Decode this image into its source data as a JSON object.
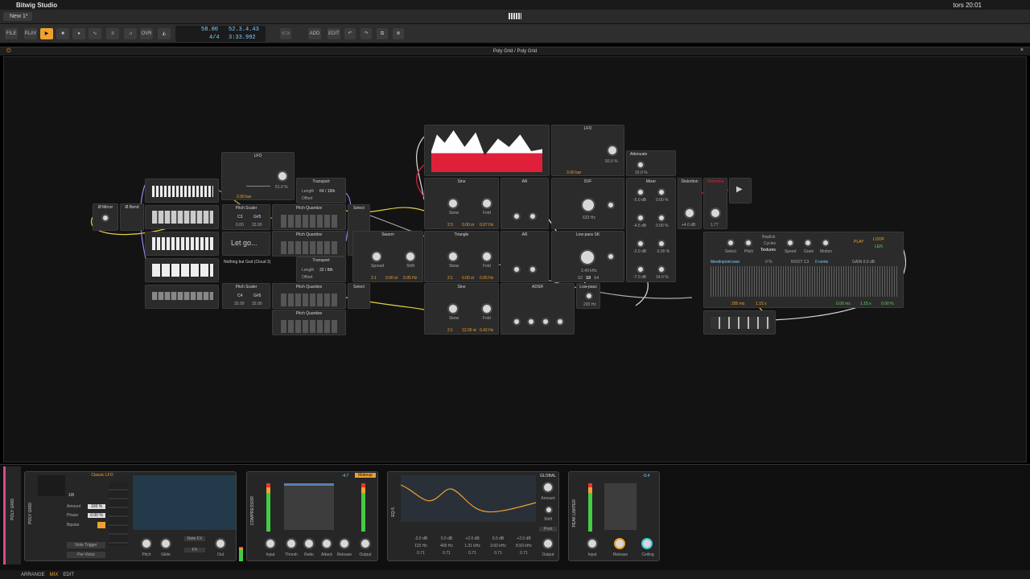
{
  "mac": {
    "app": "Bitwig Studio",
    "clock": "tors 20:01"
  },
  "tab": {
    "label": "New 1*"
  },
  "transport": {
    "file": "FILE",
    "play": "PLAY",
    "add": "ADD",
    "edit": "EDIT",
    "ovr": "OVR",
    "tempo": "58.00",
    "time_sig": "4/4",
    "position": "52.3.4.43",
    "time": "3:33.992"
  },
  "panel": {
    "title": "Poly Grid / Poly Grid"
  },
  "modules": {
    "lfo1": "LFO",
    "lfo1_rate": "2.00 bar",
    "lfo1_val": "51.0 %",
    "mirror": "Ø Mirror",
    "bend": "Ø Bend",
    "transport1": "Transport",
    "transport1_len": "Length",
    "transport1_lenv": "64 / 16th",
    "transport1_off": "Offset",
    "transport2": "Transport",
    "transport2_len": "Length",
    "transport2_lenv": "32 / 8th",
    "transport2_off": "Offset",
    "pitchscaler1": "Pitch Scaler",
    "ps1_c": "C3",
    "ps1_g": "G#5",
    "ps1_a": "0.00",
    "ps1_b": "32.00",
    "pitchscaler2": "Pitch Scaler",
    "ps2_c": "C4",
    "ps2_g": "G#5",
    "ps2_a": "32.00",
    "ps2_b": "32.00",
    "pq": "Pitch Quantize",
    "pqz": "Pitch Quantize",
    "select": "Select",
    "letgo": "Let go...",
    "comment": "Nothing but God (Cloud 3)",
    "swarm": "Swarm",
    "spread": "Spread",
    "shift": "Shift",
    "swarm_a": "2:1",
    "swarm_b": "0.00 st",
    "swarm_c": "0.05 Hz",
    "sine1": "Sine",
    "triangle": "Triangle",
    "sine2": "Sine",
    "skew": "Skew",
    "fold": "Fold",
    "osc1_a": "2:3",
    "osc1_b": "0.00 st",
    "osc1_c": "0.07 Hz",
    "osc2_a": "2:1",
    "osc2_b": "0.00 st",
    "osc2_c": "0.05 Hz",
    "osc3_a": "2:1",
    "osc3_b": "12.00 st",
    "osc3_c": "0.42 Hz",
    "ar1": "AR",
    "ar2": "AR",
    "adsr": "ADSR",
    "lfo2": "LFO",
    "lfo2_rate": "3.00 bar",
    "lfo2_val": "50.0 %",
    "attenuate": "Attenuate",
    "att_val": "15.0 %",
    "svf": "SVF",
    "svf_freq": "633 Hz",
    "lp": "Low-pass SK",
    "lp_freq": "2.40 kHz",
    "lp_a": "S2",
    "lp_b": "S8",
    "lp_c": "S4",
    "lowpass": "Low-pass",
    "lowpass_freq": "220 Hz",
    "mixer": "Mixer",
    "mix1a": "-5.0 dB",
    "mix1b": "0.00 %",
    "mix2a": "-4.5 dB",
    "mix2b": "0.00 %",
    "mix3a": "-2.0 dB",
    "mix3b": "-3.00 %",
    "mix4a": "-7.0 dB",
    "mix4b": "14.0 %",
    "distortion": "Distortion",
    "dist_val": "+4.0 dB",
    "dist2": "Distortion",
    "dist2_val": "1.77",
    "replick": "Replick",
    "cycles": "Cycles",
    "textures": "Textures",
    "sampler_play": "PLAY",
    "sampler_loop": "LOOP",
    "sampler_len": "LEN",
    "sampler_file": "Meetinpoint.wav",
    "sampler_pct": "0 %",
    "sampler_root": "ROOT C3",
    "sampler_cents": "0 cents",
    "sampler_gain": "GAIN 0.0 dB",
    "sampler_ms": "295 ms",
    "sampler_x": "1.15 x",
    "sampler_loopms": "0.00 ms",
    "sampler_loopx": "1.15 x",
    "sampler_loopp": "0.00 %",
    "s_select": "Select",
    "s_pitch": "Pitch",
    "s_speed": "Speed",
    "s_grain": "Grain",
    "s_motion": "Motion"
  },
  "devices": {
    "track": "POLY GRID",
    "polygrid": "POLY GRID",
    "lfo_preset": "Classic LFO",
    "rate": "1/8",
    "amount": "Amount",
    "amount_v": "100 %",
    "phase": "Phase",
    "phase_v": "0.00 %",
    "bipolar": "Bipolar",
    "note_trigger": "Note Trigger",
    "per_voice": "Per-Voice",
    "pitch": "Pitch",
    "glide": "Glide",
    "out": "Out",
    "notefx": "Note FX",
    "fx": "FX",
    "comp": "COMPRESSOR",
    "comp_val": "-4.7",
    "makeup": "Makeup",
    "input": "Input",
    "thresh": "Thresh",
    "ratio": "Ratio",
    "attack": "Attack",
    "release": "Release",
    "output": "Output",
    "eq": "EQ-5",
    "global": "GLOBAL",
    "eq_amount": "Amount",
    "eq_shift": "Shift",
    "eq_post": "Post",
    "eq_b1": "-3.0 dB",
    "eq_b2": "0.0 dB",
    "eq_b3": "+2.0 dB",
    "eq_b4": "0.0 dB",
    "eq_b5": "+2.0 dB",
    "eq_f1": "115 Hz",
    "eq_f2": "400 Hz",
    "eq_f3": "1.31 kHz",
    "eq_f4": "3.60 kHz",
    "eq_f5": "8.50 kHz",
    "eq_q": "0.71",
    "limiter": "PEAK LIMITER",
    "lim_val": "-0.4",
    "lim_input": "Input",
    "lim_release": "Release",
    "lim_ceiling": "Ceiling"
  },
  "status": {
    "arrange": "ARRANGE",
    "mix": "MIX",
    "edit": "EDIT"
  },
  "colors": {
    "accent": "#f0a030",
    "red": "#e0203a",
    "cyan": "#40c8d8"
  }
}
